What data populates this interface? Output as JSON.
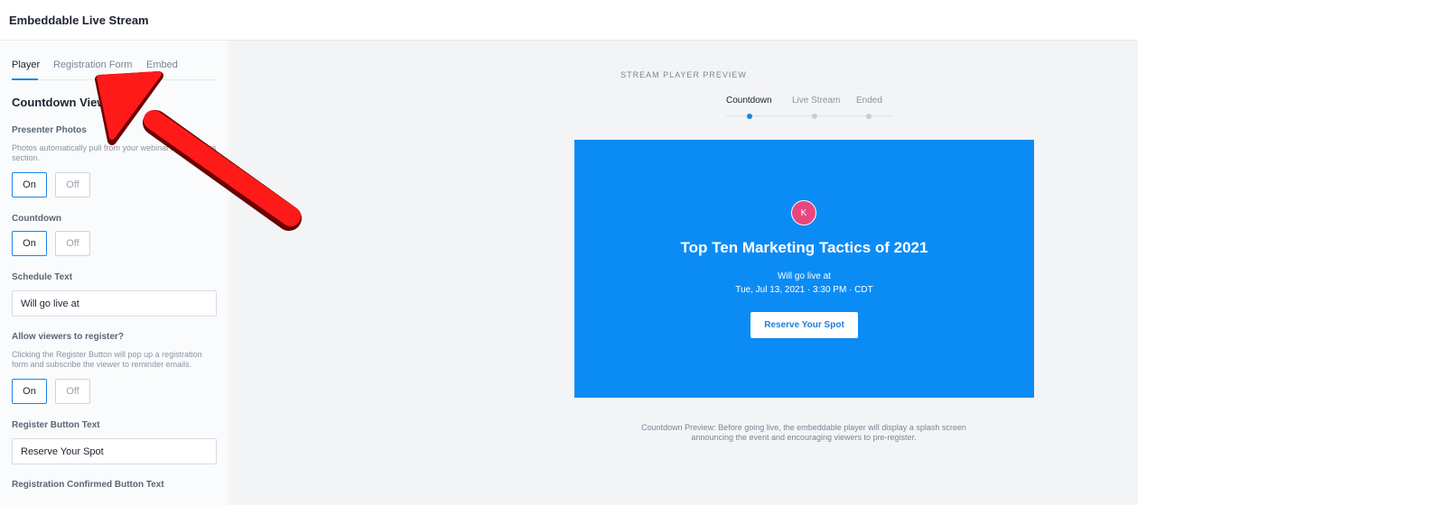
{
  "app": {
    "title": "Embeddable Live Stream"
  },
  "sidebar": {
    "tabs": [
      {
        "label": "Player",
        "active": true
      },
      {
        "label": "Registration Form",
        "active": false
      },
      {
        "label": "Embed",
        "active": false
      }
    ],
    "section_title": "Countdown View",
    "presenter_photos": {
      "label": "Presenter Photos",
      "help": "Photos automatically pull from your webinar's Presenters section.",
      "on_label": "On",
      "off_label": "Off",
      "value": "On"
    },
    "countdown": {
      "label": "Countdown",
      "on_label": "On",
      "off_label": "Off",
      "value": "On"
    },
    "schedule_text": {
      "label": "Schedule Text",
      "value": "Will go live at"
    },
    "allow_register": {
      "label": "Allow viewers to register?",
      "help": "Clicking the Register Button will pop up a registration form and subscribe the viewer to reminder emails.",
      "on_label": "On",
      "off_label": "Off",
      "value": "On"
    },
    "register_button_text": {
      "label": "Register Button Text",
      "value": "Reserve Your Spot"
    },
    "registration_confirmed": {
      "label": "Registration Confirmed Button Text"
    }
  },
  "preview": {
    "header": "STREAM PLAYER PREVIEW",
    "steps": [
      {
        "label": "Countdown",
        "active": true
      },
      {
        "label": "Live Stream",
        "active": false
      },
      {
        "label": "Ended",
        "active": false
      }
    ],
    "player": {
      "avatar_initial": "K",
      "title": "Top Ten Marketing Tactics of 2021",
      "schedule_text": "Will go live at",
      "schedule_date": "Tue, Jul 13, 2021 · 3:30 PM · CDT",
      "button_label": "Reserve Your Spot",
      "background_color": "#0b8cf5",
      "avatar_color": "#e8467c"
    },
    "caption": "Countdown Preview: Before going live, the embeddable player will display a splash screen announcing the event and encouraging viewers to pre-register."
  },
  "colors": {
    "accent": "#1a86e8",
    "annotation_arrow": "#ff1a1a"
  },
  "annotation": {
    "icon": "red-arrow-icon"
  }
}
